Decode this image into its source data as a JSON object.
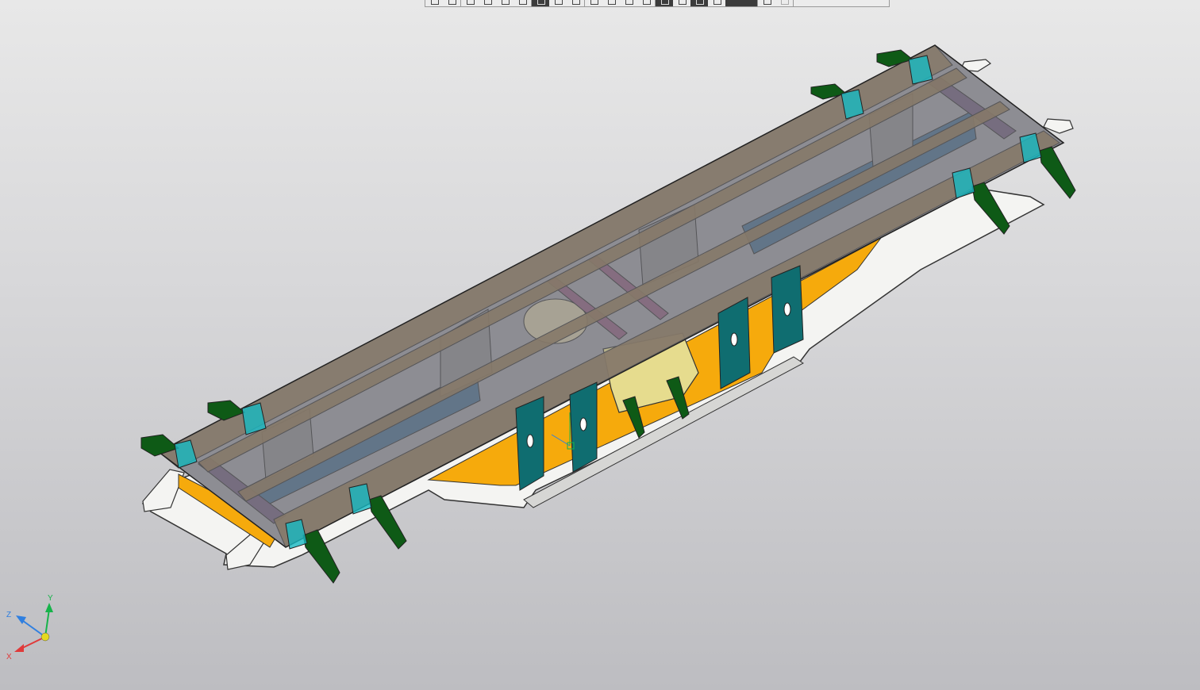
{
  "viewport": {
    "background_top": "#e8e8e8",
    "background_bottom": "#bdbdc1"
  },
  "toolbar": {
    "groups": [
      {
        "buttons": [
          {
            "icon": "save-icon"
          },
          {
            "icon": "copy-icon"
          }
        ]
      },
      {
        "buttons": [
          {
            "icon": "arrow-icon"
          },
          {
            "icon": "arrow-icon"
          },
          {
            "icon": "select-icon"
          },
          {
            "icon": "select-icon"
          }
        ]
      },
      {
        "buttons": [
          {
            "icon": "shaded-view-icon",
            "active": true
          },
          {
            "icon": "wireframe-view-icon"
          },
          {
            "icon": "hidden-lines-icon"
          }
        ]
      },
      {
        "buttons": [
          {
            "icon": "rotate-icon"
          },
          {
            "icon": "pan-icon"
          },
          {
            "icon": "zoom-icon"
          },
          {
            "icon": "zoom-fit-icon"
          }
        ]
      },
      {
        "buttons": [
          {
            "icon": "display-mode-icon",
            "active": true
          },
          {
            "icon": "display-mode-icon"
          },
          {
            "icon": "display-mode-icon",
            "active": true
          },
          {
            "icon": "display-mode-icon"
          },
          {
            "icon": "dark-panel",
            "active": true
          }
        ]
      },
      {
        "buttons": [
          {
            "icon": "camera-icon"
          },
          {
            "icon": "camera-icon",
            "disabled": true
          }
        ]
      }
    ]
  },
  "model": {
    "colors": {
      "top_plate": "#7f7f86",
      "side_rail": "#8c7452",
      "frame_base": "#f4f4f2",
      "yellow_web": "#f6aa0c",
      "blue_stiffener": "#4b6d8a",
      "rib_green": "#0e5a16",
      "teal_plate": "#0f6d70",
      "cyan_block": "#17b9c2",
      "purple_bar": "#8a5f7d",
      "gusset_gray": "#8a8b8d"
    }
  },
  "axis_triad": {
    "labels": {
      "x": "X",
      "y": "Y",
      "z": "Z"
    },
    "colors": {
      "x": "#e03a3a",
      "y": "#16b34a",
      "z": "#2f7fe0",
      "origin": "#e6d91f"
    }
  }
}
